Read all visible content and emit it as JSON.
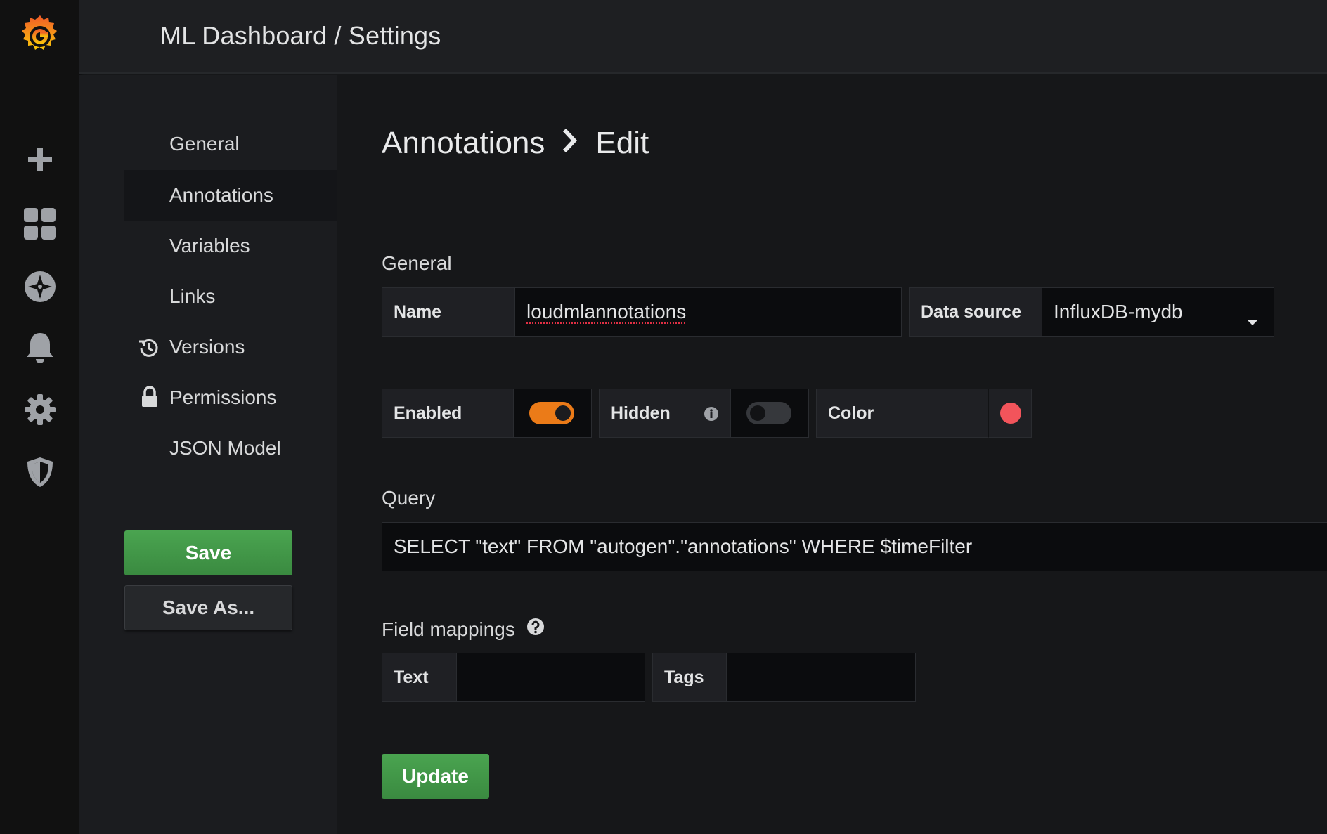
{
  "header": {
    "breadcrumb": "ML Dashboard / Settings"
  },
  "rail": {
    "icons": [
      "grafana-logo-icon",
      "plus-icon",
      "dashboards-icon",
      "explore-icon",
      "alerting-bell-icon",
      "gear-icon",
      "shield-icon"
    ]
  },
  "nav": {
    "items": [
      {
        "label": "General"
      },
      {
        "label": "Annotations"
      },
      {
        "label": "Variables"
      },
      {
        "label": "Links"
      },
      {
        "label": "Versions"
      },
      {
        "label": "Permissions"
      },
      {
        "label": "JSON Model"
      }
    ],
    "active": "Annotations",
    "save_label": "Save",
    "save_as_label": "Save As..."
  },
  "page": {
    "title_part1": "Annotations",
    "title_part2": "Edit",
    "general_heading": "General",
    "name_label": "Name",
    "name_value": "loudmlannotations",
    "datasource_label": "Data source",
    "datasource_value": "InfluxDB-mydb",
    "enabled_label": "Enabled",
    "enabled": true,
    "hidden_label": "Hidden",
    "hidden": false,
    "color_label": "Color",
    "color_value": "#f2545b",
    "query_heading": "Query",
    "query_value": "SELECT \"text\" FROM \"autogen\".\"annotations\" WHERE $timeFilter",
    "field_mappings_heading": "Field mappings",
    "text_label": "Text",
    "text_value": "",
    "tags_label": "Tags",
    "tags_value": "",
    "update_label": "Update"
  },
  "colors": {
    "accent_orange": "#eb7b18",
    "success_green": "#3d9b42",
    "annotation_color": "#f2545b"
  }
}
